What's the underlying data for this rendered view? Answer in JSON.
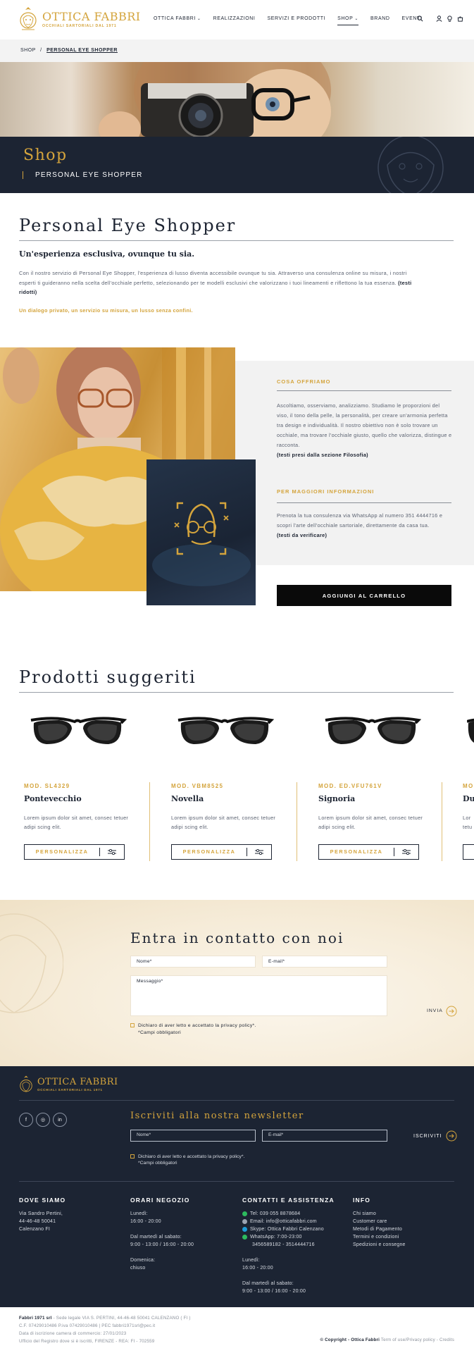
{
  "header": {
    "logo_name": "OTTICA FABBRI",
    "logo_tagline": "OCCHIALI SARTORIALI DAL 1971",
    "nav": [
      {
        "label": "OTTICA FABBRI",
        "caret": "⌄"
      },
      {
        "label": "REALIZZAZIONI",
        "caret": ""
      },
      {
        "label": "SERVIZI E PRODOTTI",
        "caret": ""
      },
      {
        "label": "SHOP",
        "caret": "⌄"
      },
      {
        "label": "BRAND",
        "caret": ""
      },
      {
        "label": "EVENTI",
        "caret": ""
      }
    ],
    "active_nav": "SHOP"
  },
  "breadcrumb": {
    "root": "SHOP",
    "separator": "/",
    "current": "PERSONAL EYE SHOPPER"
  },
  "hero": {
    "title": "Shop",
    "subtitle": "PERSONAL EYE SHOPPER"
  },
  "intro": {
    "title": "Personal Eye Shopper",
    "subtitle": "Un'esperienza esclusiva, ovunque tu sia.",
    "body": "Con il nostro servizio di Personal Eye Shopper, l'esperienza di lusso diventa accessibile ovunque tu sia. Attraverso una consulenza online su misura, i nostri esperti ti guideranno nella scelta dell'occhiale perfetto, selezionando per te modelli esclusivi che valorizzano i tuoi lineamenti e riflettono la tua essenza.",
    "body_note": "(testi ridotti)",
    "tagline": "Un dialogo privato, un servizio su misura, un lusso senza confini."
  },
  "info": {
    "offer_title": "COSA OFFRIAMO",
    "offer_body": "Ascoltiamo, osserviamo, analizziamo. Studiamo le proporzioni del viso, il tono della pelle, la personalità, per creare un'armonia perfetta tra design e individualità. Il nostro obiettivo non è solo trovare un occhiale, ma trovare l'occhiale giusto, quello che valorizza, distingue e racconta.",
    "offer_note": "(testi presi dalla sezione Filosofia)",
    "more_title": "PER MAGGIORI INFORMAZIONI",
    "more_body": "Prenota la tua consulenza via WhatsApp al numero 351 4444716 e scopri l'arte dell'occhiale sartoriale, direttamente da casa tua.",
    "more_note": "(testi da verificare)",
    "cart_button": "AGGIUNGI AL CARRELLO"
  },
  "products": {
    "title": "Prodotti suggeriti",
    "button_label": "PERSONALIZZA",
    "items": [
      {
        "code": "MOD. SL4329",
        "name": "Pontevecchio",
        "desc": "Lorem ipsum dolor sit amet, consec tetuer adipi scing elit."
      },
      {
        "code": "MOD. VBM8525",
        "name": "Novella",
        "desc": "Lorem ipsum dolor sit amet, consec tetuer adipi scing elit."
      },
      {
        "code": "MOD. ED.VFU761V",
        "name": "Signoria",
        "desc": "Lorem ipsum dolor sit amet, consec tetuer adipi scing elit."
      },
      {
        "code": "MOD.",
        "name": "Du",
        "desc": "Lor tetu"
      }
    ]
  },
  "contact": {
    "title": "Entra in contatto con noi",
    "name_ph": "Nome*",
    "email_ph": "E-mail*",
    "message_ph": "Messaggio*",
    "privacy": "Dichiaro di aver letto e accettato la privacy policy*.",
    "required": "*Campi obbligatori",
    "send": "INVIA"
  },
  "footer": {
    "logo_name": "OTTICA FABBRI",
    "logo_tagline": "OCCHIALI SARTORIALI DAL 1971",
    "social": [
      "f",
      "◎",
      "in"
    ],
    "newsletter_title": "Iscriviti alla nostra newsletter",
    "nl_name_ph": "Nome*",
    "nl_email_ph": "E-mail*",
    "nl_send": "ISCRIVITI",
    "nl_privacy": "Dichiaro di aver letto e accettato la privacy policy*.",
    "nl_required": "*Campi obbligatori",
    "where_title": "DOVE SIAMO",
    "where_lines": [
      "Via Sandro Pertini,",
      "44-46-48 50041",
      "Calenzano FI"
    ],
    "hours_title": "ORARI NEGOZIO",
    "hours_1": [
      "Lunedì:",
      "16:00 - 20:00"
    ],
    "hours_2": [
      "Dal martedì al sabato:",
      "9:00 - 13:00 / 16:00 - 20:00"
    ],
    "hours_3": [
      "Domenica:",
      "chiuso"
    ],
    "contact_title": "CONTATTI E ASSISTENZA",
    "contact_lines": [
      {
        "text": "Tel: 039 055 8878684",
        "color": "#2dbb5e"
      },
      {
        "text": "Email: info@otticafabbri.com",
        "color": "#9aa3b2"
      },
      {
        "text": "Skype: Ottica Fabbri Calenzano",
        "color": "#1d9bd8"
      },
      {
        "text": "WhatsApp: 7:00-23:00",
        "color": "#2dbb5e"
      }
    ],
    "whatsapp_numbers": "3456589182 - 3514444716",
    "contact_hours_1": [
      "Lunedì:",
      "16:00 - 20:00"
    ],
    "contact_hours_2": [
      "Dal martedì al sabato:",
      "9:00 - 13:00 / 16:00 - 20:00"
    ],
    "info_title": "INFO",
    "info_links": [
      "Chi siamo",
      "Customer care",
      "Metodi di Pagamento",
      "Termini e condizioni",
      "Spedizioni e consegne"
    ]
  },
  "bottom": {
    "company": "Fabbri 1971 srl",
    "line1": " - Sede legale VIA S. PERTINI, 44-46-48 50041 CALENZANO ( FI )",
    "line2": "C.F. 07429010486 P.iva 07429010486 | PEC fabbri1971srl@pec.it",
    "line3": "Data di iscrizione camera di commercio: 27/01/2023",
    "line4": "Ufficio del Registro dove si è iscritti, FIRENZE - REA: FI - 702559",
    "copyright_prefix": "© Copyright - ",
    "copyright_name": "Ottica Fabbri",
    "copyright_links": " Term of use/Privacy policy - Credits"
  },
  "colors": {
    "gold": "#d4a43c",
    "navy": "#1c2433",
    "grey_bg": "#f2f2f2"
  }
}
